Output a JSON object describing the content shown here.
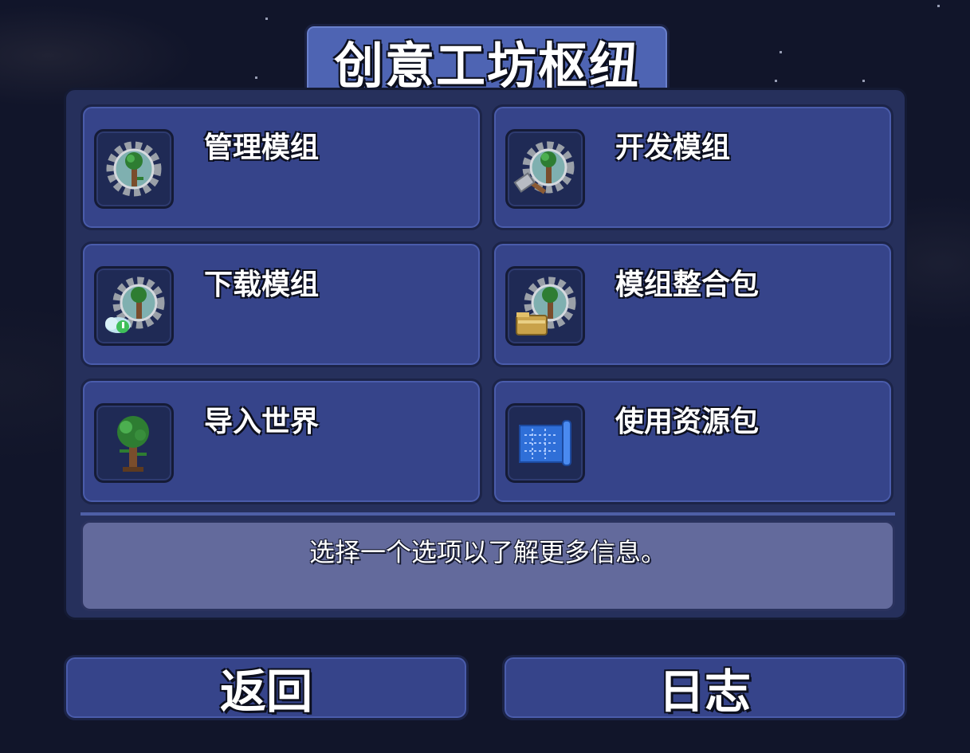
{
  "title": "创意工坊枢纽",
  "menu": {
    "items": [
      {
        "label": "管理模组",
        "icon": "gear-tree-icon"
      },
      {
        "label": "开发模组",
        "icon": "gear-tree-hammer-icon"
      },
      {
        "label": "下载模组",
        "icon": "gear-tree-cloud-icon"
      },
      {
        "label": "模组整合包",
        "icon": "gear-tree-folder-icon"
      },
      {
        "label": "导入世界",
        "icon": "tree-icon"
      },
      {
        "label": "使用资源包",
        "icon": "blueprint-icon"
      }
    ]
  },
  "info": {
    "text": "选择一个选项以了解更多信息。"
  },
  "buttons": {
    "back": "返回",
    "log": "日志"
  },
  "colors": {
    "panel": "#26305c",
    "tile": "#36448a",
    "title_plate": "#4e64b3",
    "info_box": "#636a9c"
  }
}
